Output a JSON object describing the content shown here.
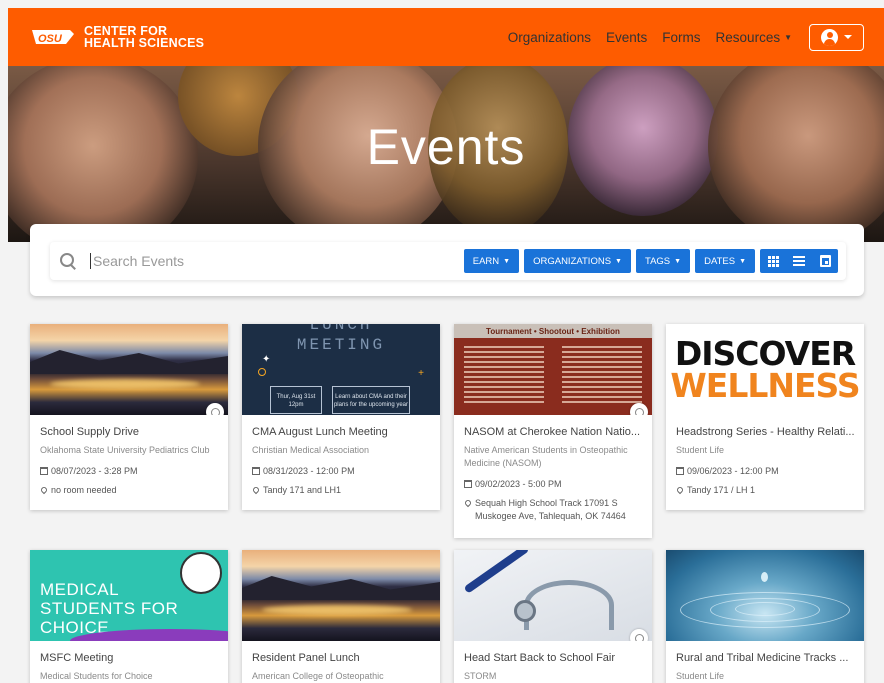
{
  "header": {
    "logo_mark": "OSU",
    "logo_line1": "CENTER FOR",
    "logo_line2": "HEALTH SCIENCES",
    "nav": [
      "Organizations",
      "Events",
      "Forms",
      "Resources"
    ]
  },
  "hero": {
    "title": "Events"
  },
  "search": {
    "placeholder": "Search Events",
    "filters": [
      "EARN",
      "ORGANIZATIONS",
      "TAGS",
      "DATES"
    ]
  },
  "events": [
    {
      "title": "School Supply Drive",
      "org": "Oklahoma State University Pediatrics Club",
      "date": "08/07/2023 - 3:28 PM",
      "location": "no room needed"
    },
    {
      "title": "CMA August Lunch Meeting",
      "org": "Christian Medical Association",
      "date": "08/31/2023 - 12:00 PM",
      "location": "Tandy 171 and LH1",
      "thumb": {
        "line1": "LUNCH",
        "line2": "MEETING",
        "box1": "Thur, Aug 31st 12pm",
        "box2": "Learn about CMA and their plans for the upcoming year"
      }
    },
    {
      "title": "NASOM at Cherokee Nation Natio...",
      "org": "Native American Students in Osteopathic Medicine (NASOM)",
      "date": "09/02/2023 - 5:00 PM",
      "location": "Sequah High School Track 17091 S Muskogee Ave, Tahlequah, OK 74464",
      "thumb": {
        "header": "Tournament • Shootout • Exhibition"
      }
    },
    {
      "title": "Headstrong Series - Healthy Relati...",
      "org": "Student Life",
      "date": "09/06/2023 - 12:00 PM",
      "location": "Tandy 171 / LH 1",
      "thumb": {
        "line1": "DISCOVER",
        "line2": "WELLNESS"
      }
    },
    {
      "title": "MSFC Meeting",
      "org": "Medical Students for Choice",
      "thumb": {
        "line1": "MEDICAL",
        "line2": "STUDENTS FOR",
        "line3": "CHOICE"
      }
    },
    {
      "title": "Resident Panel Lunch",
      "org": "American College of Osteopathic"
    },
    {
      "title": "Head Start Back to School Fair",
      "org": "STORM"
    },
    {
      "title": "Rural and Tribal Medicine Tracks ...",
      "org": "Student Life"
    }
  ]
}
